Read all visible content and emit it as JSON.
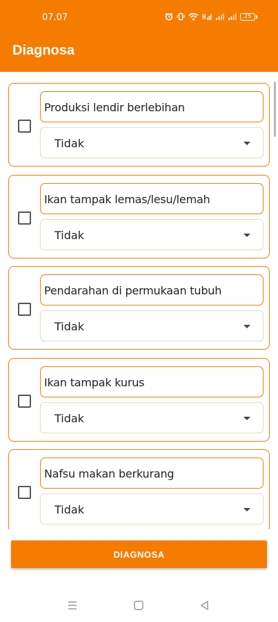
{
  "status_bar": {
    "time": "07.07",
    "battery_level": "25"
  },
  "app_bar": {
    "title": "Diagnosa"
  },
  "symptoms": [
    {
      "label": "Produksi lendir berlebihan",
      "answer": "Tidak",
      "checked": false
    },
    {
      "label": "Ikan tampak lemas/lesu/lemah",
      "answer": "Tidak",
      "checked": false
    },
    {
      "label": "Pendarahan di permukaan tubuh",
      "answer": "Tidak",
      "checked": false
    },
    {
      "label": "Ikan tampak kurus",
      "answer": "Tidak",
      "checked": false
    },
    {
      "label": "Nafsu makan berkurang",
      "answer": "Tidak",
      "checked": false
    }
  ],
  "actions": {
    "diagnosa_label": "DIAGNOSA"
  },
  "colors": {
    "accent": "#f57c00",
    "background": "#ffffff"
  },
  "icons": {
    "status": [
      "alarm-icon",
      "vibrate-icon",
      "wifi-icon",
      "hd-signal-icon",
      "signal-icon",
      "signal-icon",
      "battery-icon"
    ],
    "nav": [
      "recents-icon",
      "home-icon",
      "back-icon"
    ]
  }
}
